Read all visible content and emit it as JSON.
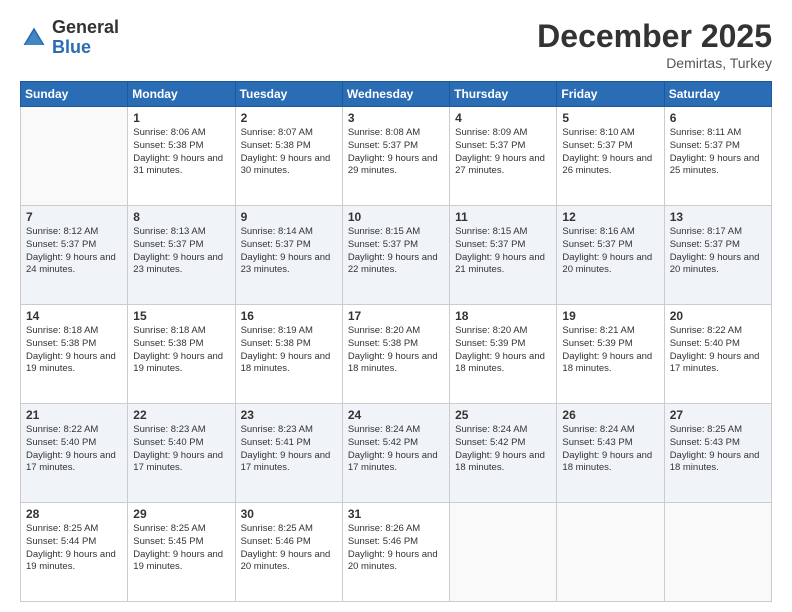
{
  "header": {
    "logo_general": "General",
    "logo_blue": "Blue",
    "month": "December 2025",
    "location": "Demirtas, Turkey"
  },
  "columns": [
    "Sunday",
    "Monday",
    "Tuesday",
    "Wednesday",
    "Thursday",
    "Friday",
    "Saturday"
  ],
  "weeks": [
    {
      "shaded": false,
      "days": [
        {
          "num": "",
          "empty": true
        },
        {
          "num": "1",
          "sunrise": "8:06 AM",
          "sunset": "5:38 PM",
          "daylight": "9 hours and 31 minutes."
        },
        {
          "num": "2",
          "sunrise": "8:07 AM",
          "sunset": "5:38 PM",
          "daylight": "9 hours and 30 minutes."
        },
        {
          "num": "3",
          "sunrise": "8:08 AM",
          "sunset": "5:37 PM",
          "daylight": "9 hours and 29 minutes."
        },
        {
          "num": "4",
          "sunrise": "8:09 AM",
          "sunset": "5:37 PM",
          "daylight": "9 hours and 27 minutes."
        },
        {
          "num": "5",
          "sunrise": "8:10 AM",
          "sunset": "5:37 PM",
          "daylight": "9 hours and 26 minutes."
        },
        {
          "num": "6",
          "sunrise": "8:11 AM",
          "sunset": "5:37 PM",
          "daylight": "9 hours and 25 minutes."
        }
      ]
    },
    {
      "shaded": true,
      "days": [
        {
          "num": "7",
          "sunrise": "8:12 AM",
          "sunset": "5:37 PM",
          "daylight": "9 hours and 24 minutes."
        },
        {
          "num": "8",
          "sunrise": "8:13 AM",
          "sunset": "5:37 PM",
          "daylight": "9 hours and 23 minutes."
        },
        {
          "num": "9",
          "sunrise": "8:14 AM",
          "sunset": "5:37 PM",
          "daylight": "9 hours and 23 minutes."
        },
        {
          "num": "10",
          "sunrise": "8:15 AM",
          "sunset": "5:37 PM",
          "daylight": "9 hours and 22 minutes."
        },
        {
          "num": "11",
          "sunrise": "8:15 AM",
          "sunset": "5:37 PM",
          "daylight": "9 hours and 21 minutes."
        },
        {
          "num": "12",
          "sunrise": "8:16 AM",
          "sunset": "5:37 PM",
          "daylight": "9 hours and 20 minutes."
        },
        {
          "num": "13",
          "sunrise": "8:17 AM",
          "sunset": "5:37 PM",
          "daylight": "9 hours and 20 minutes."
        }
      ]
    },
    {
      "shaded": false,
      "days": [
        {
          "num": "14",
          "sunrise": "8:18 AM",
          "sunset": "5:38 PM",
          "daylight": "9 hours and 19 minutes."
        },
        {
          "num": "15",
          "sunrise": "8:18 AM",
          "sunset": "5:38 PM",
          "daylight": "9 hours and 19 minutes."
        },
        {
          "num": "16",
          "sunrise": "8:19 AM",
          "sunset": "5:38 PM",
          "daylight": "9 hours and 18 minutes."
        },
        {
          "num": "17",
          "sunrise": "8:20 AM",
          "sunset": "5:38 PM",
          "daylight": "9 hours and 18 minutes."
        },
        {
          "num": "18",
          "sunrise": "8:20 AM",
          "sunset": "5:39 PM",
          "daylight": "9 hours and 18 minutes."
        },
        {
          "num": "19",
          "sunrise": "8:21 AM",
          "sunset": "5:39 PM",
          "daylight": "9 hours and 18 minutes."
        },
        {
          "num": "20",
          "sunrise": "8:22 AM",
          "sunset": "5:40 PM",
          "daylight": "9 hours and 17 minutes."
        }
      ]
    },
    {
      "shaded": true,
      "days": [
        {
          "num": "21",
          "sunrise": "8:22 AM",
          "sunset": "5:40 PM",
          "daylight": "9 hours and 17 minutes."
        },
        {
          "num": "22",
          "sunrise": "8:23 AM",
          "sunset": "5:40 PM",
          "daylight": "9 hours and 17 minutes."
        },
        {
          "num": "23",
          "sunrise": "8:23 AM",
          "sunset": "5:41 PM",
          "daylight": "9 hours and 17 minutes."
        },
        {
          "num": "24",
          "sunrise": "8:24 AM",
          "sunset": "5:42 PM",
          "daylight": "9 hours and 17 minutes."
        },
        {
          "num": "25",
          "sunrise": "8:24 AM",
          "sunset": "5:42 PM",
          "daylight": "9 hours and 18 minutes."
        },
        {
          "num": "26",
          "sunrise": "8:24 AM",
          "sunset": "5:43 PM",
          "daylight": "9 hours and 18 minutes."
        },
        {
          "num": "27",
          "sunrise": "8:25 AM",
          "sunset": "5:43 PM",
          "daylight": "9 hours and 18 minutes."
        }
      ]
    },
    {
      "shaded": false,
      "days": [
        {
          "num": "28",
          "sunrise": "8:25 AM",
          "sunset": "5:44 PM",
          "daylight": "9 hours and 19 minutes."
        },
        {
          "num": "29",
          "sunrise": "8:25 AM",
          "sunset": "5:45 PM",
          "daylight": "9 hours and 19 minutes."
        },
        {
          "num": "30",
          "sunrise": "8:25 AM",
          "sunset": "5:46 PM",
          "daylight": "9 hours and 20 minutes."
        },
        {
          "num": "31",
          "sunrise": "8:26 AM",
          "sunset": "5:46 PM",
          "daylight": "9 hours and 20 minutes."
        },
        {
          "num": "",
          "empty": true
        },
        {
          "num": "",
          "empty": true
        },
        {
          "num": "",
          "empty": true
        }
      ]
    }
  ]
}
